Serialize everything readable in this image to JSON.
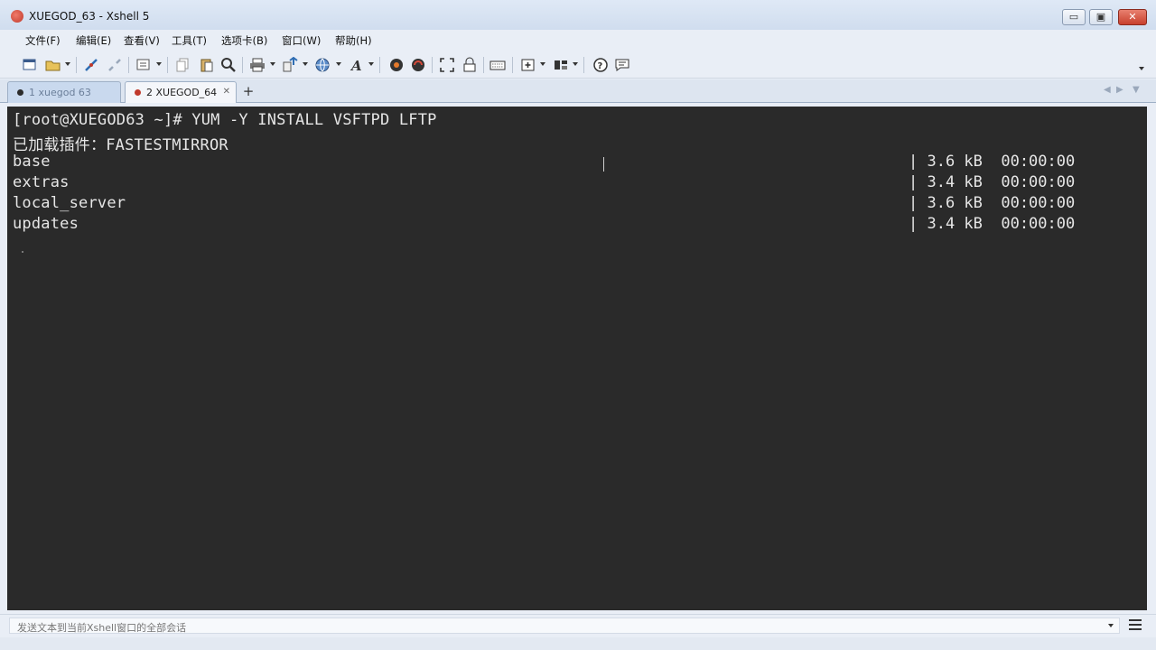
{
  "window": {
    "title": "XUEGOD_63 - Xshell 5",
    "buttons": {
      "minimize": "▭",
      "maximize": "▣",
      "close": "✕"
    }
  },
  "menu": {
    "items": [
      "文件(F)",
      "编辑(E)",
      "查看(V)",
      "工具(T)",
      "选项卡(B)",
      "窗口(W)",
      "帮助(H)"
    ]
  },
  "toolbar": {
    "icons": [
      "new-session-icon",
      "open-folder-icon",
      "connect-icon",
      "disconnect-icon",
      "properties-icon",
      "copy-icon",
      "paste-icon",
      "find-icon",
      "print-icon",
      "transfer-icon",
      "globe-icon",
      "font-icon",
      "xftp-icon",
      "xmanager-icon",
      "fullscreen-icon",
      "lock-icon",
      "keyboard-icon",
      "new-tab-icon",
      "layout-icon",
      "help-icon",
      "chat-icon"
    ]
  },
  "tabs": [
    {
      "label": "1 xuegod 63",
      "active": true,
      "dot_color": "#2b2b2b"
    },
    {
      "label": "2 XUEGOD_64",
      "active": false,
      "dot_color": "#c0392b"
    }
  ],
  "tab_add": "+",
  "terminal": {
    "lines": [
      "[root@XUEGOD63 ~]# YUM -Y INSTALL VSFTPD LFTP",
      "已加载插件：FASTESTMIRROR",
      "base",
      "extras",
      "local_server",
      "updates"
    ],
    "right_col": [
      "| 3.6 kB  00:00:00",
      "| 3.4 kB  00:00:00",
      "| 3.6 kB  00:00:00",
      "| 3.4 kB  00:00:00"
    ],
    "background": "#2a2a2a",
    "foreground": "#e6e6e6"
  },
  "compose": {
    "placeholder": "发送文本到当前Xshell窗口的全部会话"
  }
}
